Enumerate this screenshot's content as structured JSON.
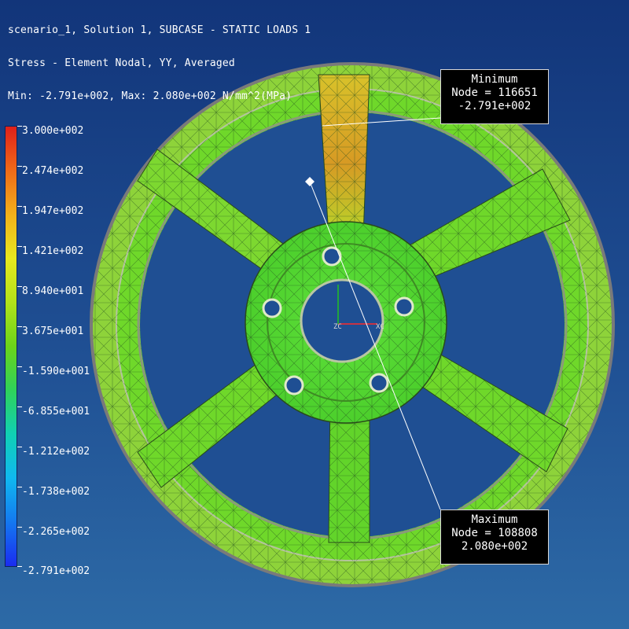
{
  "header": {
    "line1": "scenario_1, Solution 1, SUBCASE - STATIC LOADS 1",
    "line2": "Stress - Element Nodal, YY, Averaged",
    "line3": "Min: -2.791e+002, Max: 2.080e+002 N/mm^2(MPa)"
  },
  "legend": {
    "labels": [
      "3.000e+002",
      "2.474e+002",
      "1.947e+002",
      "1.421e+002",
      "8.940e+001",
      "3.675e+001",
      "-1.590e+001",
      "-6.855e+001",
      "-1.212e+002",
      "-1.738e+002",
      "-2.265e+002",
      "-2.791e+002"
    ]
  },
  "callouts": {
    "minimum": {
      "title": "Minimum",
      "node": "Node = 116651",
      "value": "-2.791e+002"
    },
    "maximum": {
      "title": "Maximum",
      "node": "Node = 108808",
      "value": "2.080e+002"
    }
  },
  "axes": {
    "origin_label": "ZC",
    "x_label": "XC"
  },
  "colors": {
    "wheel_green": "#6fd82a",
    "wheel_yellow": "#d2d22c",
    "wheel_orange": "#d99a24",
    "mesh_line": "#1f4a1a",
    "axis_x": "#ff2a2a",
    "axis_y": "#22c022"
  }
}
